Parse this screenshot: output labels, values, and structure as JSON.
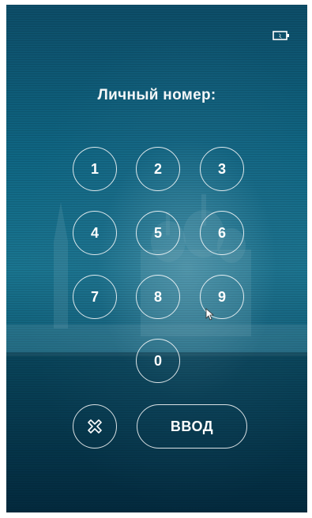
{
  "status": {
    "battery_icon": "battery-charging-icon"
  },
  "prompt": {
    "title": "Личный номер:"
  },
  "keypad": {
    "keys": [
      "1",
      "2",
      "3",
      "4",
      "5",
      "6",
      "7",
      "8",
      "9",
      "0"
    ],
    "clear_icon": "clear-x-icon",
    "enter_label": "ВВОД"
  },
  "theme": {
    "accent": "#ffffff",
    "background": "#0f6683"
  }
}
